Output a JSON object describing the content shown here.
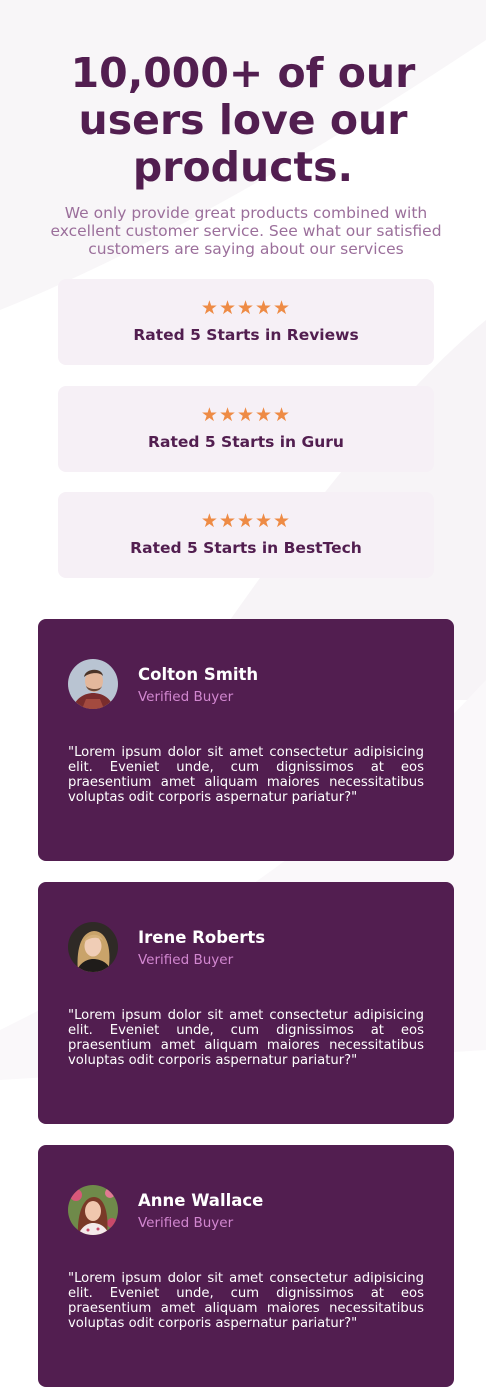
{
  "header": {
    "title": "10,000+ of our users love our products.",
    "subtitle": "We only provide great products combined with excellent customer service. See what our satisfied customers are saying about our services"
  },
  "ratings": [
    {
      "stars": "★★★★★",
      "rating_value": 5,
      "label": "Rated 5 Starts in Reviews"
    },
    {
      "stars": "★★★★★",
      "rating_value": 5,
      "label": "Rated 5 Starts in Guru"
    },
    {
      "stars": "★★★★★",
      "rating_value": 5,
      "label": "Rated 5 Starts in BestTech"
    }
  ],
  "testimonials": [
    {
      "name": "Colton Smith",
      "role": "Verified Buyer",
      "avatar": "man-portrait-icon",
      "quote": "\"Lorem ipsum dolor sit amet consectetur adipisicing elit. Eveniet unde, cum dignissimos at eos praesentium amet aliquam maiores necessitatibus voluptas odit corporis aspernatur pariatur?\""
    },
    {
      "name": "Irene Roberts",
      "role": "Verified Buyer",
      "avatar": "woman-portrait-icon",
      "quote": "\"Lorem ipsum dolor sit amet consectetur adipisicing elit. Eveniet unde, cum dignissimos at eos praesentium amet aliquam maiores necessitatibus voluptas odit corporis aspernatur pariatur?\""
    },
    {
      "name": "Anne Wallace",
      "role": "Verified Buyer",
      "avatar": "woman-portrait-icon",
      "quote": "\"Lorem ipsum dolor sit amet consectetur adipisicing elit. Eveniet unde, cum dignissimos at eos praesentium amet aliquam maiores necessitatibus voluptas odit corporis aspernatur pariatur?\""
    }
  ],
  "colors": {
    "primary": "#521e50",
    "accent_pink": "#d287d0",
    "star": "#ee8b45",
    "card_bg": "#f6f0f6",
    "subtitle": "#9b6f9b"
  }
}
